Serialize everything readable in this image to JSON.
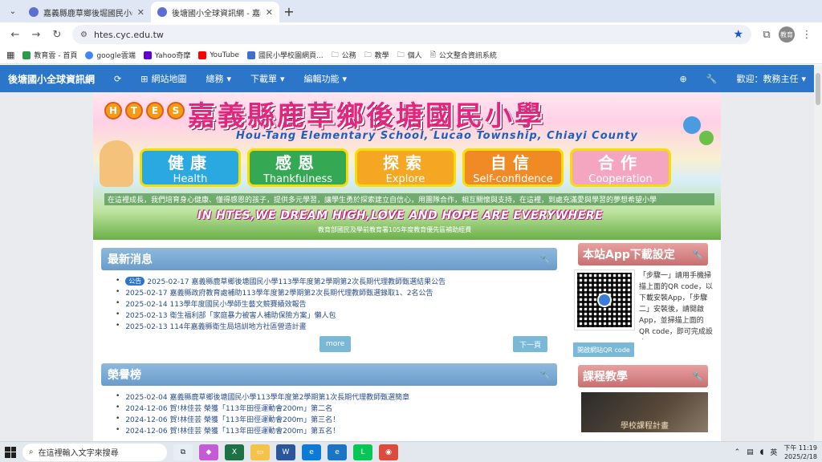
{
  "browser": {
    "tabs": [
      {
        "title": "嘉義縣鹿草鄉後堀國民小學 - 首頁",
        "active": false
      },
      {
        "title": "後塘國小全球資訊網 - 嘉義縣",
        "active": true
      }
    ],
    "url": "htes.cyc.edu.tw",
    "profile": "教育",
    "bookmarks": [
      "教育雲 - 首頁",
      "google雲端",
      "Yahoo奇摩",
      "YouTube",
      "國民小學校園網頁...",
      "公務",
      "教學",
      "個人",
      "公文整合資訊系統"
    ]
  },
  "sitenav": {
    "brand": "後塘國小全球資訊網",
    "items": [
      "網站地圖",
      "總務",
      "下載單",
      "編輯功能"
    ],
    "welcome": "歡迎：教務主任"
  },
  "banner": {
    "letters": [
      "H",
      "T",
      "E",
      "S"
    ],
    "title": "嘉義縣鹿草鄉後塘國民小學",
    "english": "Hou-Tang Elementary School, Lucao Township, Chiayi County",
    "values": [
      {
        "zh": "健康",
        "en": "Health",
        "color": "#2aa8e0"
      },
      {
        "zh": "感恩",
        "en": "Thankfulness",
        "color": "#34a853"
      },
      {
        "zh": "探索",
        "en": "Explore",
        "color": "#f5a623"
      },
      {
        "zh": "自信",
        "en": "Self-confidence",
        "color": "#f08a24"
      },
      {
        "zh": "合作",
        "en": "Cooperation",
        "color": "#f4a6c0"
      }
    ],
    "line1": "在這裡成長，我們培育身心健康、懂得感恩的孩子，提供多元學習，讓學生勇於探索建立自信心，用團隊合作，相互關懷與支持，在這裡，到處充滿愛與學習的夢想希望小學",
    "line2": "IN HTES,WE DREAM HIGH,LOVE AND HOPE ARE EVERYWHERE",
    "line3": "教育部國民及學前教育署105年度教育優先區補助經費"
  },
  "news": {
    "title": "最新消息",
    "badge": "公告",
    "items": [
      "2025-02-17 嘉義縣鹿草鄉後塘國民小學113學年度第2學期第2次長期代理教師甄選結果公告",
      "2025-02-17 嘉義縣政府教育處補助113學年度第2學期第2次長期代理教師甄選錄取1、2名公告",
      "2025-02-14 113學年度國民小學師生藝文競賽績效報告",
      "2025-02-13 衛生福利部「家庭暴力被害人補助保險方案」懶人包",
      "2025-02-13 114年嘉義縣衛生局培訓地方社區營造計畫"
    ],
    "more": "more",
    "next": "下一頁"
  },
  "honor": {
    "title": "榮譽榜",
    "items": [
      "2025-02-04 嘉義縣鹿草鄉後塘國民小學113學年度第2學期第1次長期代理教師甄選簡章",
      "2024-12-06 賀!林佳芸 榮獲「113年田徑運動會200m」第二名",
      "2024-12-06 賀!林佳芸 榮獲「113年田徑運動會200m」第三名！",
      "2024-12-06 賀!林佳芸 榮獲「113年田徑運動會200m」第五名！"
    ]
  },
  "app": {
    "title": "本站App下載設定",
    "text": "「步驟一」請用手機掃描上面的QR code，以下載安裝App，「步驟二」安裝後，請開啟App，並掃描上面的QR code，即可完成設定。",
    "button": "開啟網站QR code"
  },
  "course": {
    "title": "課程教學",
    "caption": "學校課程計畫"
  },
  "taskbar": {
    "search": "在這裡輸入文字來搜尋",
    "lang": "英",
    "time": "下午 11:19",
    "date": "2025/2/18"
  }
}
